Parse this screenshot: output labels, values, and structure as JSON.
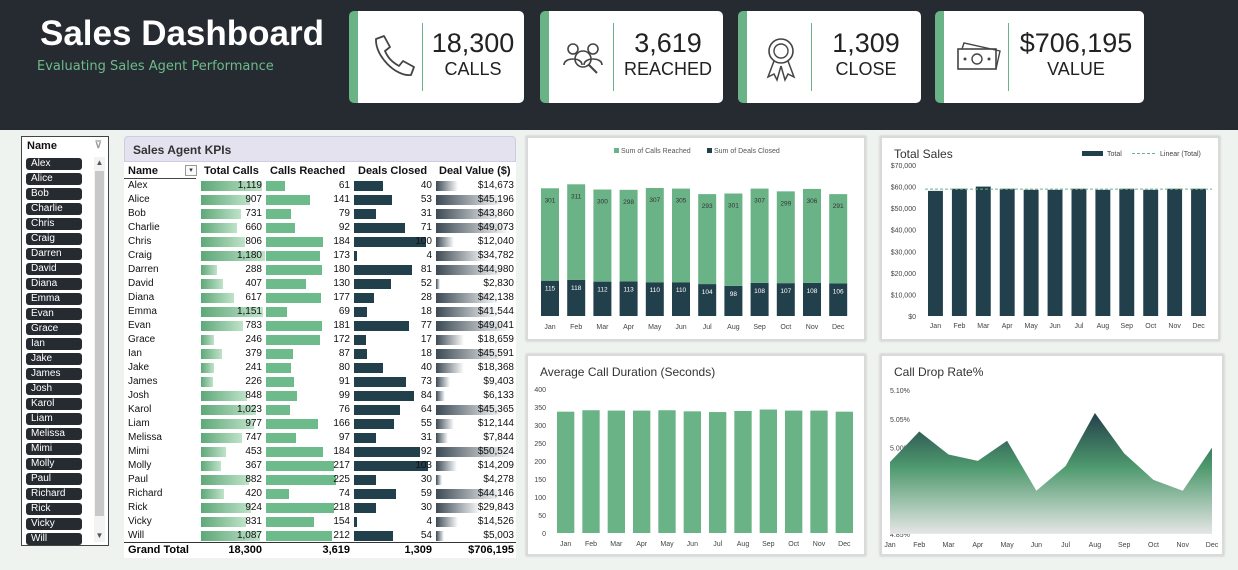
{
  "header": {
    "title": "Sales Dashboard",
    "subtitle": "Evaluating Sales Agent Performance"
  },
  "cards": [
    {
      "value": "18,300",
      "label": "CALLS",
      "icon": "phone-icon"
    },
    {
      "value": "3,619",
      "label": "REACHED",
      "icon": "people-search-icon"
    },
    {
      "value": "1,309",
      "label": "CLOSE",
      "icon": "award-ribbon-icon"
    },
    {
      "value": "$706,195",
      "label": "VALUE",
      "icon": "money-icon"
    }
  ],
  "slicer": {
    "title": "Name",
    "items": [
      "Alex",
      "Alice",
      "Bob",
      "Charlie",
      "Chris",
      "Craig",
      "Darren",
      "David",
      "Diana",
      "Emma",
      "Evan",
      "Grace",
      "Ian",
      "Jake",
      "James",
      "Josh",
      "Karol",
      "Liam",
      "Melissa",
      "Mimi",
      "Molly",
      "Paul",
      "Richard",
      "Rick",
      "Vicky",
      "Will"
    ]
  },
  "kpi": {
    "title": "Sales Agent KPIs",
    "headers": [
      "Name",
      "Total Calls",
      "Calls Reached",
      "Deals Closed",
      "Deal Value ($)"
    ],
    "rows": [
      [
        "Alex",
        "1,119",
        "61",
        "40",
        "$14,673"
      ],
      [
        "Alice",
        "907",
        "141",
        "53",
        "$45,196"
      ],
      [
        "Bob",
        "731",
        "79",
        "31",
        "$43,860"
      ],
      [
        "Charlie",
        "660",
        "92",
        "71",
        "$49,073"
      ],
      [
        "Chris",
        "806",
        "184",
        "100",
        "$12,040"
      ],
      [
        "Craig",
        "1,180",
        "173",
        "4",
        "$34,782"
      ],
      [
        "Darren",
        "288",
        "180",
        "81",
        "$44,980"
      ],
      [
        "David",
        "407",
        "130",
        "52",
        "$2,830"
      ],
      [
        "Diana",
        "617",
        "177",
        "28",
        "$42,138"
      ],
      [
        "Emma",
        "1,151",
        "69",
        "18",
        "$41,544"
      ],
      [
        "Evan",
        "783",
        "181",
        "77",
        "$49,041"
      ],
      [
        "Grace",
        "246",
        "172",
        "17",
        "$18,659"
      ],
      [
        "Ian",
        "379",
        "87",
        "18",
        "$45,591"
      ],
      [
        "Jake",
        "241",
        "80",
        "40",
        "$18,368"
      ],
      [
        "James",
        "226",
        "91",
        "73",
        "$9,403"
      ],
      [
        "Josh",
        "848",
        "99",
        "84",
        "$6,133"
      ],
      [
        "Karol",
        "1,023",
        "76",
        "64",
        "$45,365"
      ],
      [
        "Liam",
        "977",
        "166",
        "55",
        "$12,144"
      ],
      [
        "Melissa",
        "747",
        "97",
        "31",
        "$7,844"
      ],
      [
        "Mimi",
        "453",
        "184",
        "92",
        "$50,524"
      ],
      [
        "Molly",
        "367",
        "217",
        "103",
        "$14,209"
      ],
      [
        "Paul",
        "882",
        "225",
        "30",
        "$4,278"
      ],
      [
        "Richard",
        "420",
        "74",
        "59",
        "$44,146"
      ],
      [
        "Rick",
        "924",
        "218",
        "30",
        "$29,843"
      ],
      [
        "Vicky",
        "831",
        "154",
        "4",
        "$14,526"
      ],
      [
        "Will",
        "1,087",
        "212",
        "54",
        "$5,003"
      ]
    ],
    "bar_values": {
      "calls": [
        1119,
        907,
        731,
        660,
        806,
        1180,
        288,
        407,
        617,
        1151,
        783,
        246,
        379,
        241,
        226,
        848,
        1023,
        977,
        747,
        453,
        367,
        882,
        420,
        924,
        831,
        1087
      ],
      "reached": [
        61,
        141,
        79,
        92,
        184,
        173,
        180,
        130,
        177,
        69,
        181,
        172,
        87,
        80,
        91,
        99,
        76,
        166,
        97,
        184,
        217,
        225,
        74,
        218,
        154,
        212
      ],
      "closed": [
        40,
        53,
        31,
        71,
        100,
        4,
        81,
        52,
        28,
        18,
        77,
        17,
        18,
        40,
        73,
        84,
        64,
        55,
        31,
        92,
        103,
        30,
        59,
        30,
        4,
        54
      ],
      "value": [
        14673,
        45196,
        43860,
        49073,
        12040,
        34782,
        44980,
        2830,
        42138,
        41544,
        49041,
        18659,
        45591,
        18368,
        9403,
        6133,
        45365,
        12144,
        7844,
        50524,
        14209,
        4278,
        44146,
        29843,
        14526,
        5003
      ]
    },
    "grand_total": {
      "label": "Grand Total",
      "calls": "18,300",
      "reached": "3,619",
      "closed": "1,309",
      "value": "$706,195"
    }
  },
  "chart_data": [
    {
      "id": "reached-closed",
      "type": "bar",
      "stacked": true,
      "categories": [
        "Jan",
        "Feb",
        "Mar",
        "Apr",
        "May",
        "Jun",
        "Jul",
        "Aug",
        "Sep",
        "Oct",
        "Nov",
        "Dec"
      ],
      "series": [
        {
          "name": "Sum of Calls Reached",
          "values": [
            301,
            311,
            300,
            298,
            307,
            305,
            293,
            301,
            307,
            299,
            306,
            291
          ],
          "color": "#6ab387"
        },
        {
          "name": "Sum of Deals Closed",
          "values": [
            115,
            118,
            112,
            113,
            110,
            110,
            104,
            98,
            108,
            107,
            108,
            106
          ],
          "color": "#22404b"
        }
      ],
      "legend": "top"
    },
    {
      "id": "total-sales",
      "type": "bar",
      "title": "Total Sales",
      "categories": [
        "Jan",
        "Feb",
        "Mar",
        "Apr",
        "May",
        "Jun",
        "Jul",
        "Aug",
        "Sep",
        "Oct",
        "Nov",
        "Dec"
      ],
      "series": [
        {
          "name": "Total",
          "values": [
            58000,
            59000,
            60000,
            59000,
            58500,
            58500,
            59000,
            58500,
            59000,
            58500,
            59000,
            59000
          ],
          "color": "#22404b"
        }
      ],
      "trendline": {
        "name": "Linear (Total)",
        "color": "#6ab387"
      },
      "ylim": [
        0,
        70000
      ],
      "yticks": [
        "$0",
        "$10,000",
        "$20,000",
        "$30,000",
        "$40,000",
        "$50,000",
        "$60,000",
        "$70,000"
      ],
      "legend": "top-right"
    },
    {
      "id": "avg-call-duration",
      "type": "bar",
      "title": "Average Call Duration (Seconds)",
      "categories": [
        "Jan",
        "Feb",
        "Mar",
        "Apr",
        "May",
        "Jun",
        "Jul",
        "Aug",
        "Sep",
        "Oct",
        "Nov",
        "Dec"
      ],
      "values": [
        337,
        341,
        340,
        340,
        341,
        338,
        336,
        339,
        343,
        340,
        340,
        337
      ],
      "color": "#6ab387",
      "ylim": [
        0,
        400
      ],
      "yticks": [
        "0",
        "50",
        "100",
        "150",
        "200",
        "250",
        "300",
        "350",
        "400"
      ]
    },
    {
      "id": "call-drop-rate",
      "type": "area",
      "title": "Call Drop Rate%",
      "categories": [
        "Jan",
        "Feb",
        "Mar",
        "Apr",
        "May",
        "Jun",
        "Jul",
        "Aug",
        "Sep",
        "Oct",
        "Nov",
        "Dec"
      ],
      "values": [
        4.975,
        5.028,
        4.988,
        4.977,
        5.012,
        4.925,
        4.968,
        5.06,
        4.99,
        4.944,
        4.925,
        5.0
      ],
      "ylim": [
        4.85,
        5.1
      ],
      "yticks": [
        "4.85%",
        "4.90%",
        "4.95%",
        "5.00%",
        "5.05%",
        "5.10%"
      ]
    }
  ]
}
